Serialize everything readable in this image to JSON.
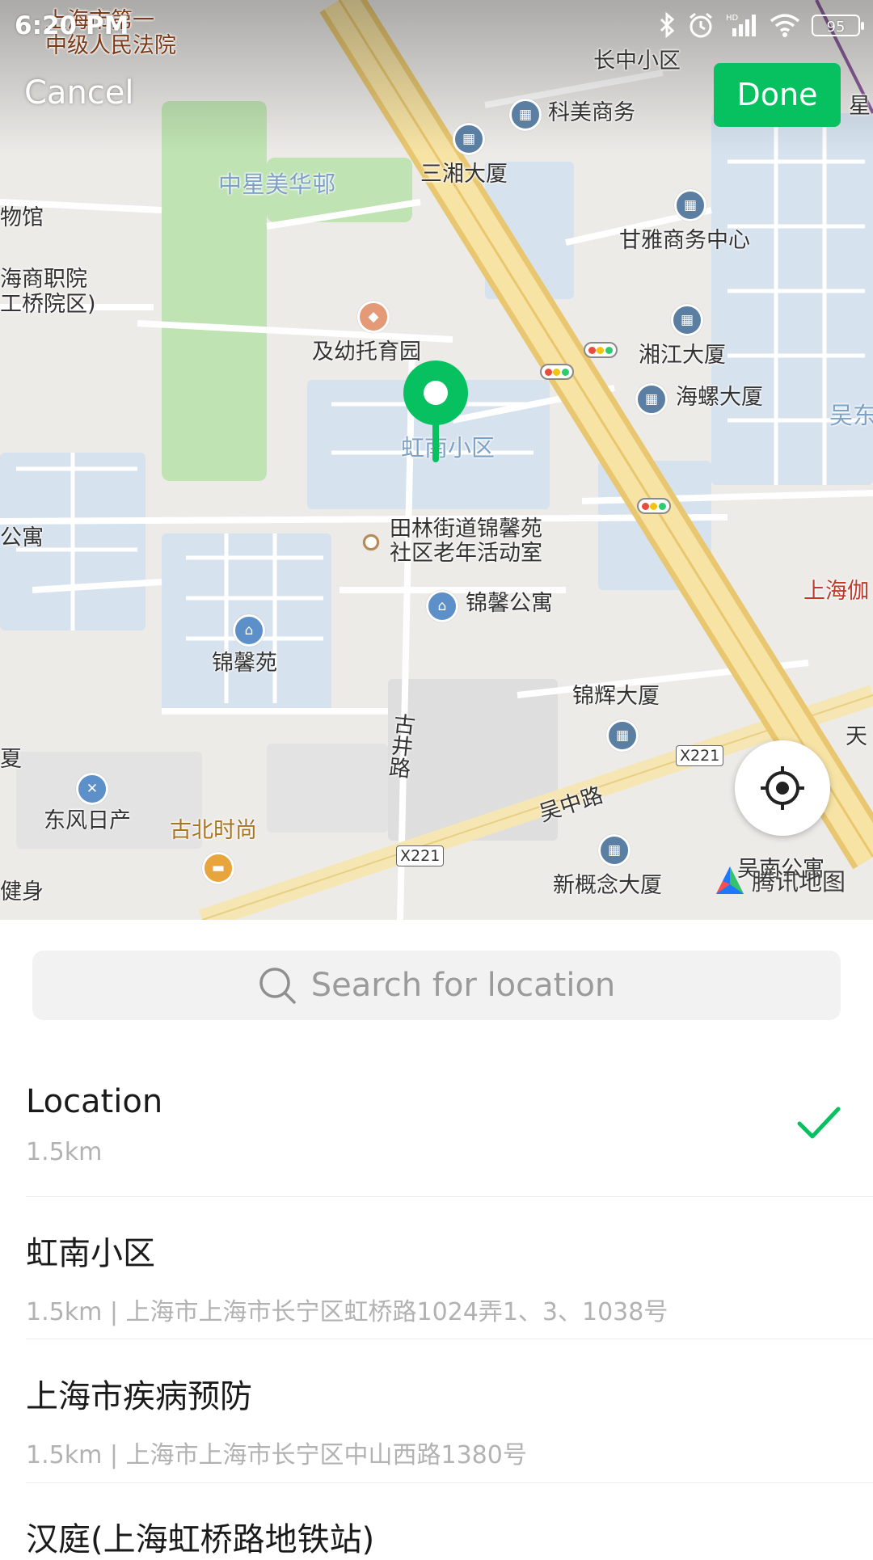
{
  "status_bar": {
    "time": "6:20 PM",
    "battery": "95",
    "icons": [
      "bluetooth-icon",
      "alarm-icon",
      "hd-signal-icon",
      "wifi-icon",
      "battery-icon"
    ]
  },
  "header": {
    "cancel_label": "Cancel",
    "done_label": "Done",
    "done_color": "#07C160"
  },
  "map": {
    "brand": "腾讯地图",
    "labels": {
      "court": "上海市第一\n中级人民法院",
      "changzhong": "长中小区",
      "kemei": "科美商务",
      "zhongxing": "中星美华邨",
      "sanxiang": "三湘大厦",
      "museum": "物馆",
      "ganya": "甘雅商务中心",
      "vocational": "海商职院\n工桥院区)",
      "kindergarten": "及幼托育园",
      "xiangjiang": "湘江大厦",
      "hailuo": "海螺大厦",
      "wudong": "吴东",
      "honnan": "虹南小区",
      "tianlin": "田林街道锦馨苑\n社区老年活动室",
      "apartment_left": "公寓",
      "jinxin_apartment": "锦馨公寓",
      "shanghai_jia": "上海伽",
      "jinxinyuan": "锦馨苑",
      "jinhui": "锦辉大厦",
      "tian": "天",
      "gujing_road": "古井路",
      "road_tag_1": "X221",
      "road_tag_2": "X221",
      "xia": "夏",
      "wuzhong_road": "吴中路",
      "dongfeng": "东风日产",
      "gubei": "古北时尚",
      "wunan": "吴南公寓",
      "xingainian": "新概念大厦",
      "jianshen": "健身",
      "xing": "星"
    }
  },
  "search": {
    "placeholder": "Search for location"
  },
  "results": [
    {
      "title": "Location",
      "subtitle": "1.5km",
      "selected": true
    },
    {
      "title": "虹南小区",
      "subtitle": "1.5km | 上海市上海市长宁区虹桥路1024弄1、3、1038号",
      "selected": false
    },
    {
      "title": "上海市疾病预防",
      "subtitle": "1.5km | 上海市上海市长宁区中山西路1380号",
      "selected": false
    },
    {
      "title": "汉庭(上海虹桥路地铁站)",
      "subtitle": "",
      "selected": false
    }
  ],
  "colors": {
    "accent": "#07C160",
    "pin": "#07C160"
  }
}
